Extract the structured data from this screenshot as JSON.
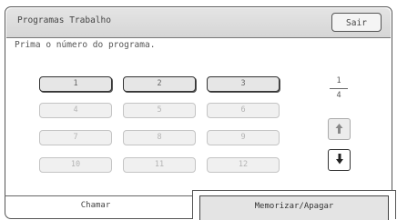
{
  "header": {
    "title": "Programas Trabalho",
    "exit_label": "Sair"
  },
  "instruction": "Prima o número do programa.",
  "programs": [
    {
      "label": "1",
      "enabled": true
    },
    {
      "label": "2",
      "enabled": true
    },
    {
      "label": "3",
      "enabled": true
    },
    {
      "label": "4",
      "enabled": false
    },
    {
      "label": "5",
      "enabled": false
    },
    {
      "label": "6",
      "enabled": false
    },
    {
      "label": "7",
      "enabled": false
    },
    {
      "label": "8",
      "enabled": false
    },
    {
      "label": "9",
      "enabled": false
    },
    {
      "label": "10",
      "enabled": false
    },
    {
      "label": "11",
      "enabled": false
    },
    {
      "label": "12",
      "enabled": false
    }
  ],
  "pager": {
    "current": "1",
    "total": "4",
    "up_icon": "arrow-up-icon",
    "down_icon": "arrow-down-icon"
  },
  "tabs": [
    {
      "label": "Chamar",
      "active": false
    },
    {
      "label": "Memorizar/Apagar",
      "active": true
    }
  ]
}
